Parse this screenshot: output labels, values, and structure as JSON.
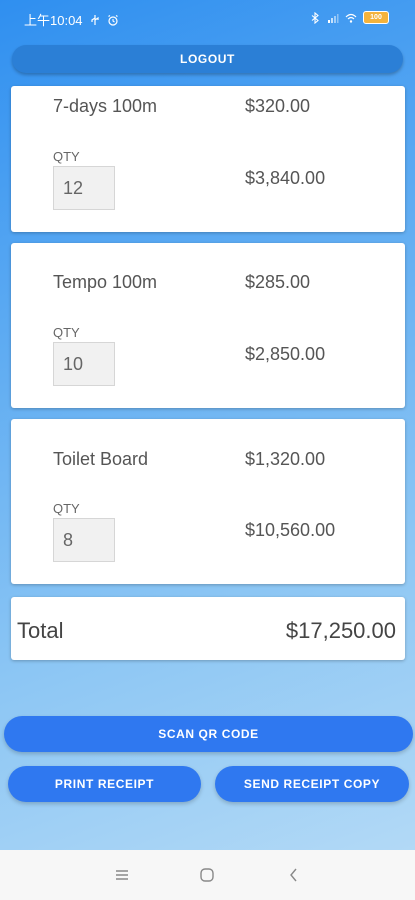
{
  "status_bar": {
    "time": "上午10:04",
    "battery_text": "100",
    "icons": [
      "usb-icon",
      "alarm-icon",
      "bluetooth-icon",
      "signal-icon",
      "wifi-icon",
      "battery-icon"
    ]
  },
  "header": {
    "logout_label": "LOGOUT"
  },
  "items": [
    {
      "name": "7-days 100m",
      "unit_price": "$320.00",
      "qty_label": "QTY",
      "qty": "12",
      "line_total": "$3,840.00"
    },
    {
      "name": "Tempo 100m",
      "unit_price": "$285.00",
      "qty_label": "QTY",
      "qty": "10",
      "line_total": "$2,850.00"
    },
    {
      "name": "Toilet Board",
      "unit_price": "$1,320.00",
      "qty_label": "QTY",
      "qty": "8",
      "line_total": "$10,560.00"
    }
  ],
  "total": {
    "label": "Total",
    "value": "$17,250.00"
  },
  "actions": {
    "scan_label": "SCAN QR CODE",
    "print_label": "PRINT RECEIPT",
    "send_label": "SEND RECEIPT COPY"
  },
  "nav_bar": {
    "icons": [
      "menu-icon",
      "home-icon",
      "back-icon"
    ]
  },
  "colors": {
    "primary": "#2f78f0",
    "logout": "#2b7fd6",
    "card": "#ffffff"
  }
}
